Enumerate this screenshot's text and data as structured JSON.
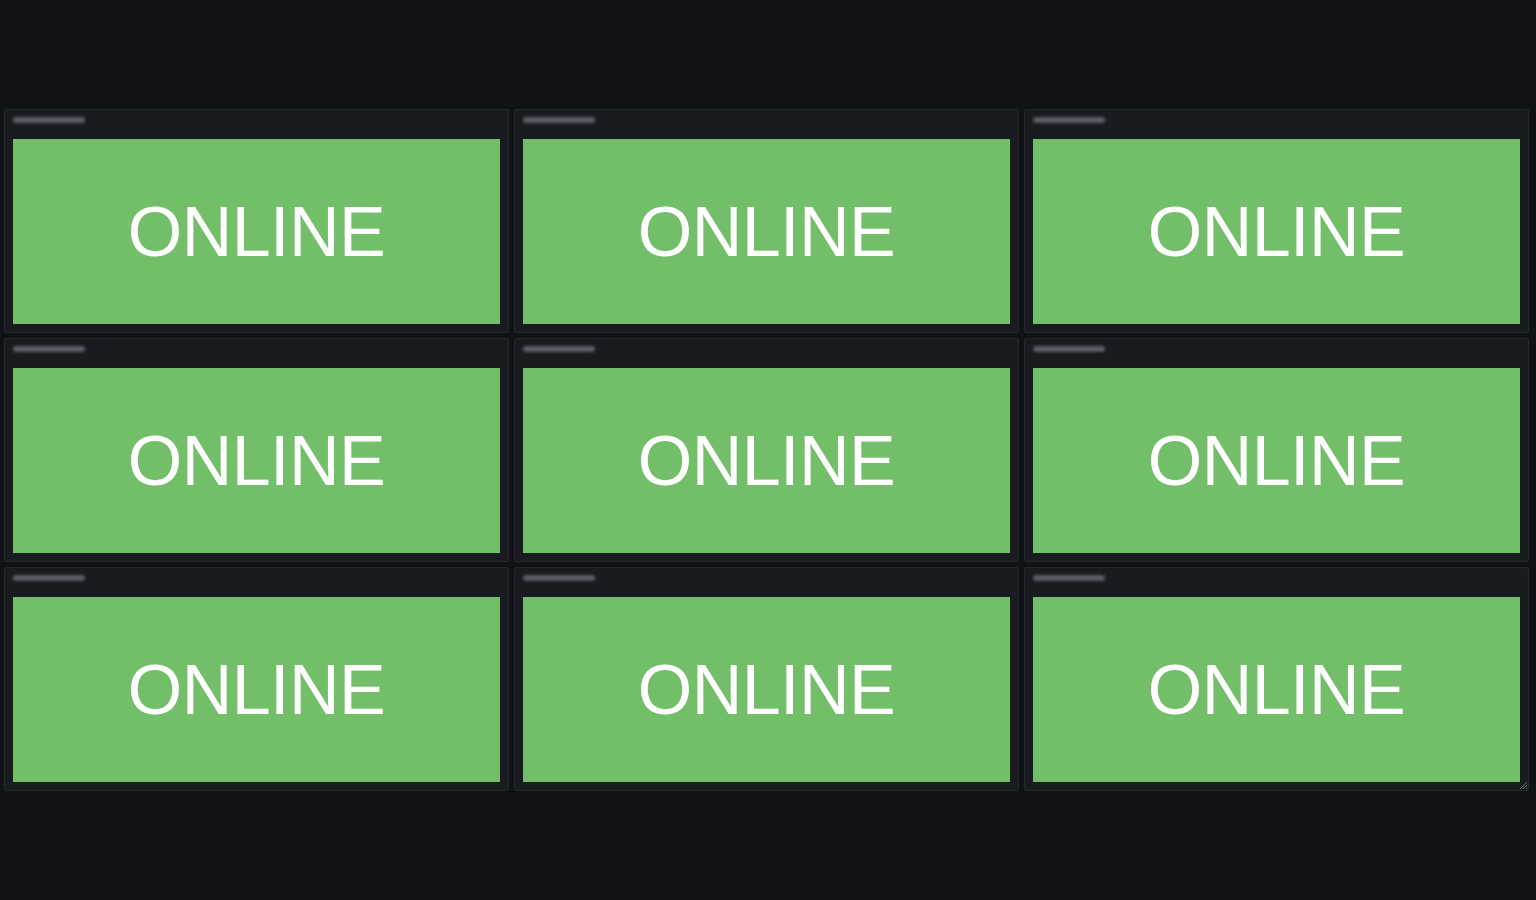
{
  "panels": [
    {
      "title_blurred": true,
      "online": true,
      "status": "ONLINE"
    },
    {
      "title_blurred": true,
      "online": true,
      "status": "ONLINE"
    },
    {
      "title_blurred": true,
      "online": true,
      "status": "ONLINE"
    },
    {
      "title_blurred": true,
      "online": true,
      "status": "ONLINE"
    },
    {
      "title_blurred": true,
      "online": true,
      "status": "ONLINE"
    },
    {
      "title_blurred": true,
      "online": true,
      "status": "ONLINE"
    },
    {
      "title_blurred": true,
      "online": true,
      "status": "ONLINE"
    },
    {
      "title_blurred": true,
      "online": true,
      "status": "ONLINE"
    },
    {
      "title_blurred": true,
      "online": true,
      "status": "ONLINE"
    }
  ]
}
